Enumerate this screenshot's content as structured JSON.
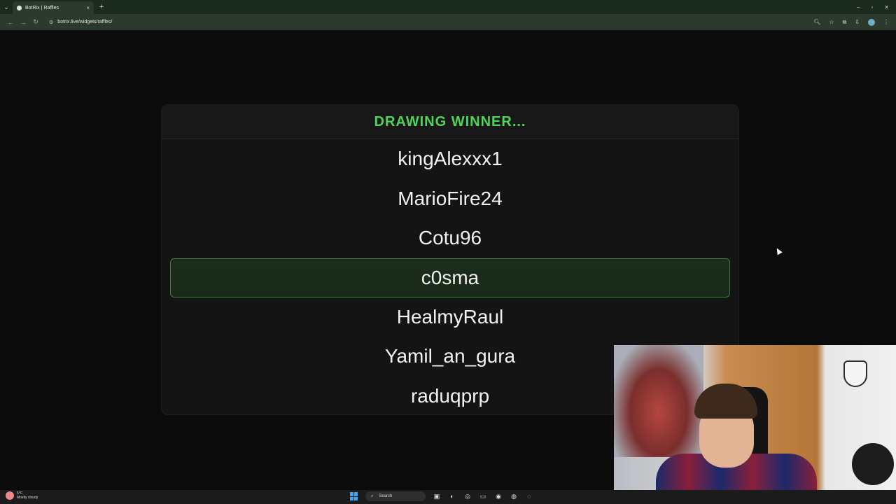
{
  "browser": {
    "tab_title": "BotRix | Raffles",
    "tab_close": "×",
    "new_tab": "+",
    "url": "botrix.live/widgets/raffles/",
    "window_controls": [
      "–",
      "▫",
      "✕"
    ]
  },
  "raffle": {
    "header": "DRAWING WINNER...",
    "names": [
      "kingAlexxx1",
      "MarioFire24",
      "Cotu96",
      "c0sma",
      "HealmyRaul",
      "Yamil_an_gura",
      "raduqprp"
    ],
    "selected_index": 3,
    "accent_color": "#4fd35a"
  },
  "taskbar": {
    "weather_temp": "5°C",
    "weather_desc": "Mostly cloudy",
    "search_label": "Search"
  }
}
